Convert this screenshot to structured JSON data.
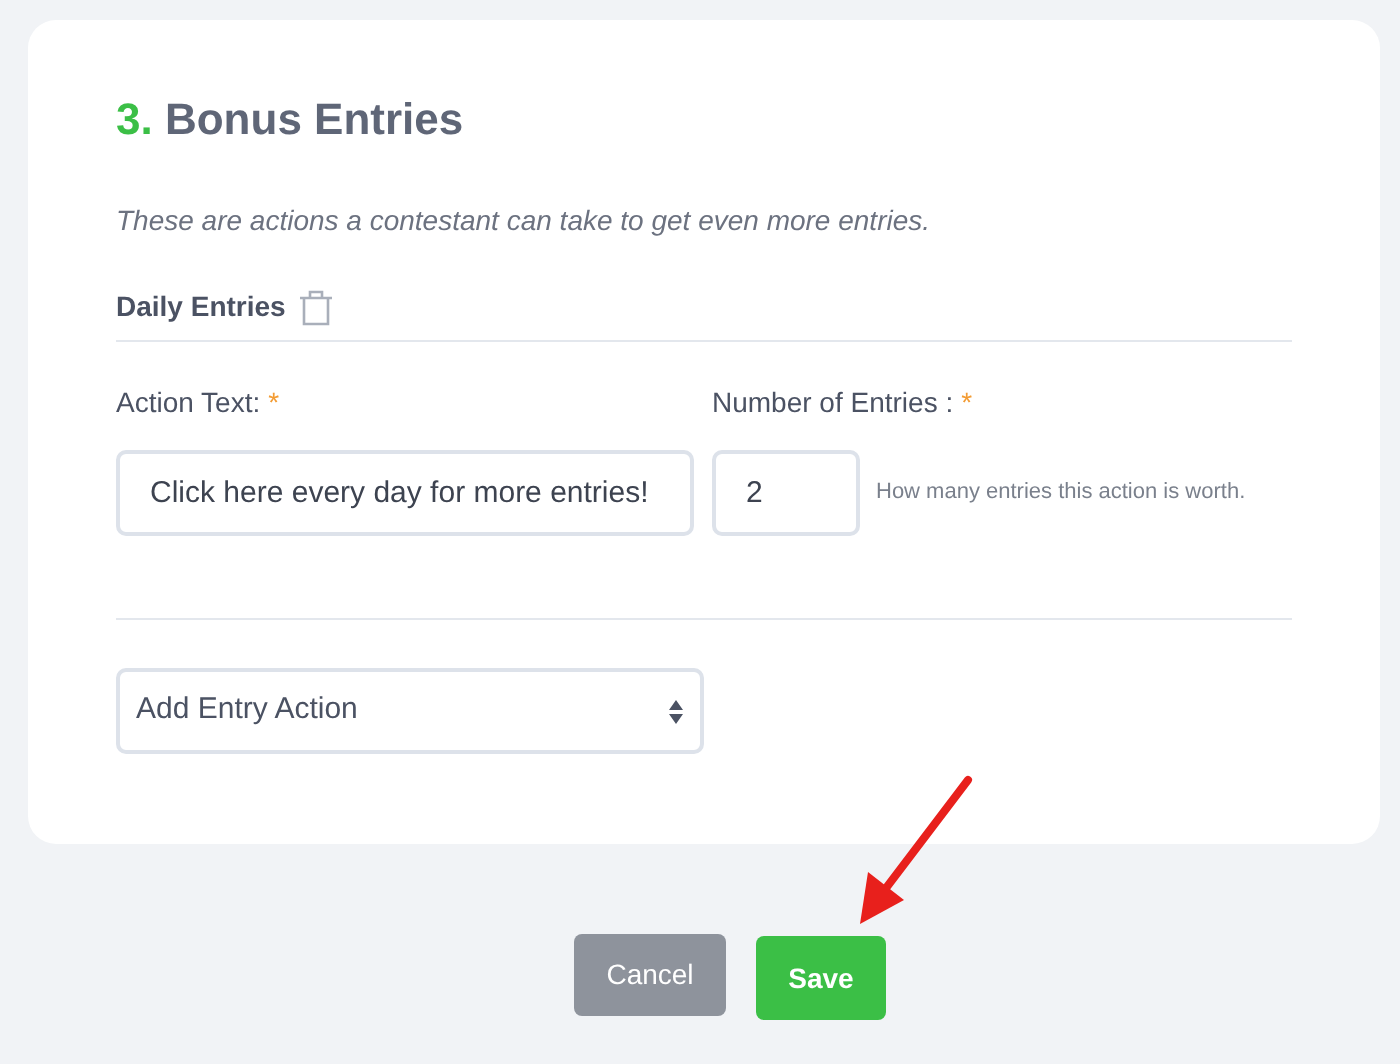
{
  "section": {
    "number": "3.",
    "title": "Bonus Entries",
    "description": "These are actions a contestant can take to get even more entries."
  },
  "entry_actions": [
    {
      "title": "Daily Entries",
      "action_text_label": "Action Text:",
      "action_text_required_mark": "*",
      "action_text_value": "Click here every day for more entries!",
      "entries_label": "Number of Entries :",
      "entries_required_mark": "*",
      "entries_value": "2",
      "entries_hint": "How many entries this action is worth."
    }
  ],
  "add_action_select": {
    "value": "Add Entry Action"
  },
  "buttons": [
    {
      "label": "Cancel",
      "kind": "secondary"
    },
    {
      "label": "Save",
      "kind": "primary"
    }
  ]
}
